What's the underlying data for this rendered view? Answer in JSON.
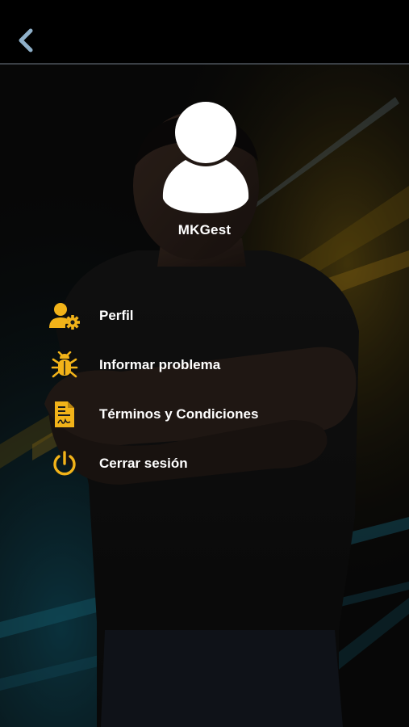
{
  "header": {
    "back_icon": "chevron-left-icon"
  },
  "profile": {
    "username": "MKGest",
    "avatar_icon": "user-silhouette-icon"
  },
  "menu": {
    "items": [
      {
        "label": "Perfil",
        "icon": "user-gear-icon"
      },
      {
        "label": "Informar problema",
        "icon": "bug-icon"
      },
      {
        "label": "Términos y Condiciones",
        "icon": "document-signature-icon"
      },
      {
        "label": "Cerrar sesión",
        "icon": "power-icon"
      }
    ]
  },
  "colors": {
    "accent": "#f2b319",
    "header_bg": "#000000",
    "text": "#ffffff",
    "back_arrow": "#8fb0c9"
  }
}
